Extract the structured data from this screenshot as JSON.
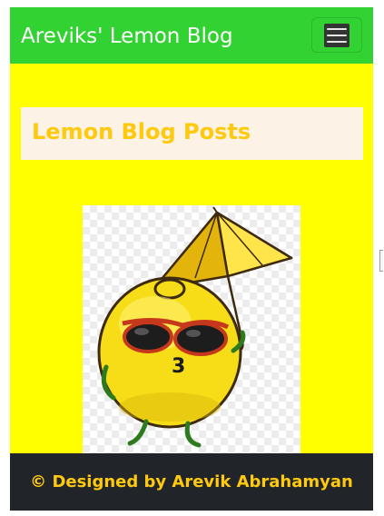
{
  "navbar": {
    "brand": "Areviks' Lemon Blog",
    "toggler_icon": "hamburger-menu-icon"
  },
  "posts": {
    "title": "Lemon Blog Posts"
  },
  "image": {
    "subject": "lemon mascot with sunglasses and umbrella",
    "label": "3"
  },
  "footer": {
    "text": "© Designed by Arevik Abrahamyan"
  },
  "colors": {
    "navbar": "#32d232",
    "page_background": "#ffff00",
    "title_text": "#ffc90e",
    "posts_box": "#fdf2e6",
    "footer_background": "#212529"
  }
}
